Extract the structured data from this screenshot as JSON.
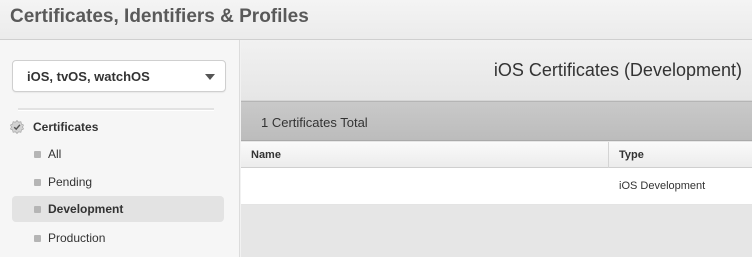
{
  "app": {
    "title": "Certificates, Identifiers & Profiles"
  },
  "sidebar": {
    "platform_select": {
      "value": "iOS, tvOS, watchOS"
    },
    "section": {
      "label": "Certificates",
      "icon": "certificate-seal-icon"
    },
    "items": [
      {
        "label": "All",
        "active": false
      },
      {
        "label": "Pending",
        "active": false
      },
      {
        "label": "Development",
        "active": true
      },
      {
        "label": "Production",
        "active": false
      }
    ]
  },
  "main": {
    "title": "iOS Certificates (Development)",
    "total_label": "1 Certificates Total",
    "table": {
      "columns": [
        "Name",
        "Type"
      ],
      "rows": [
        {
          "name": "",
          "type": "iOS Development"
        }
      ]
    }
  }
}
